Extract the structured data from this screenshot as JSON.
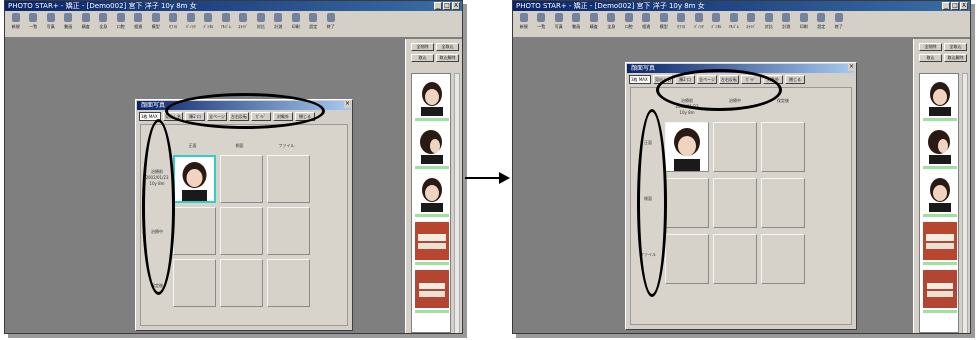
{
  "app": {
    "title": "PHOTO STAR+ - 矯正 - [Demo002]  宮下  洋子  10y 8m  女",
    "window_buttons": [
      "_",
      "□",
      "X"
    ],
    "toolbar": [
      {
        "label": "新規",
        "icon": "new-file-icon"
      },
      {
        "label": "一覧",
        "icon": "list-icon"
      },
      {
        "label": "写真",
        "icon": "photo-icon"
      },
      {
        "label": "動画",
        "icon": "video-icon"
      },
      {
        "label": "精査",
        "icon": "inspect-icon"
      },
      {
        "label": "全身",
        "icon": "body-icon"
      },
      {
        "label": "口腔",
        "icon": "mouth-icon"
      },
      {
        "label": "経過",
        "icon": "progress-icon"
      },
      {
        "label": "模型",
        "icon": "model-icon"
      },
      {
        "label": "ｾﾌｧﾛ",
        "icon": "cephalo-icon"
      },
      {
        "label": "ﾊﾟﾉﾗﾏ",
        "icon": "panorama-icon"
      },
      {
        "label": "ﾃﾞﾝﾀﾙ",
        "icon": "dental-icon"
      },
      {
        "label": "ｱﾙﾊﾞﾑ",
        "icon": "album-icon"
      },
      {
        "label": "ｽﾗｲﾄﾞ",
        "icon": "slide-icon"
      },
      {
        "label": "対比",
        "icon": "compare-icon"
      },
      {
        "label": "計測",
        "icon": "measure-icon"
      },
      {
        "label": "印刷",
        "icon": "print-icon"
      },
      {
        "label": "設定",
        "icon": "settings-icon"
      },
      {
        "label": "終了",
        "icon": "exit-icon"
      }
    ],
    "right_panel_buttons": [
      "全削除",
      "全取込",
      "取込",
      "取込解除"
    ]
  },
  "dialog": {
    "title": "顔面写真",
    "view_select": "3枚 MAX",
    "buttons": [
      "見出し名",
      "陳2 口",
      "全ページ",
      "左右反転",
      "ｶﾞｲﾄﾞ",
      "対象外",
      "閉じる"
    ]
  },
  "left_screen": {
    "column_headers": [
      "正面",
      "側面",
      "ファイル"
    ],
    "row_labels": [
      {
        "lines": [
          "治療前",
          "2002/01/23",
          "10y 8m"
        ]
      },
      {
        "lines": [
          "治療中"
        ]
      },
      {
        "lines": [
          "保定後"
        ]
      }
    ]
  },
  "right_screen": {
    "column_headers": [
      {
        "lines": [
          "治療前",
          "2002/01/23",
          "10y 8m"
        ]
      },
      {
        "lines": [
          "治療中"
        ]
      },
      {
        "lines": [
          "保定後"
        ]
      }
    ],
    "row_labels": [
      "正面",
      "側面",
      "ファイル"
    ]
  },
  "annotation": {
    "ellipse_color": "#000000",
    "arrow": "right"
  }
}
